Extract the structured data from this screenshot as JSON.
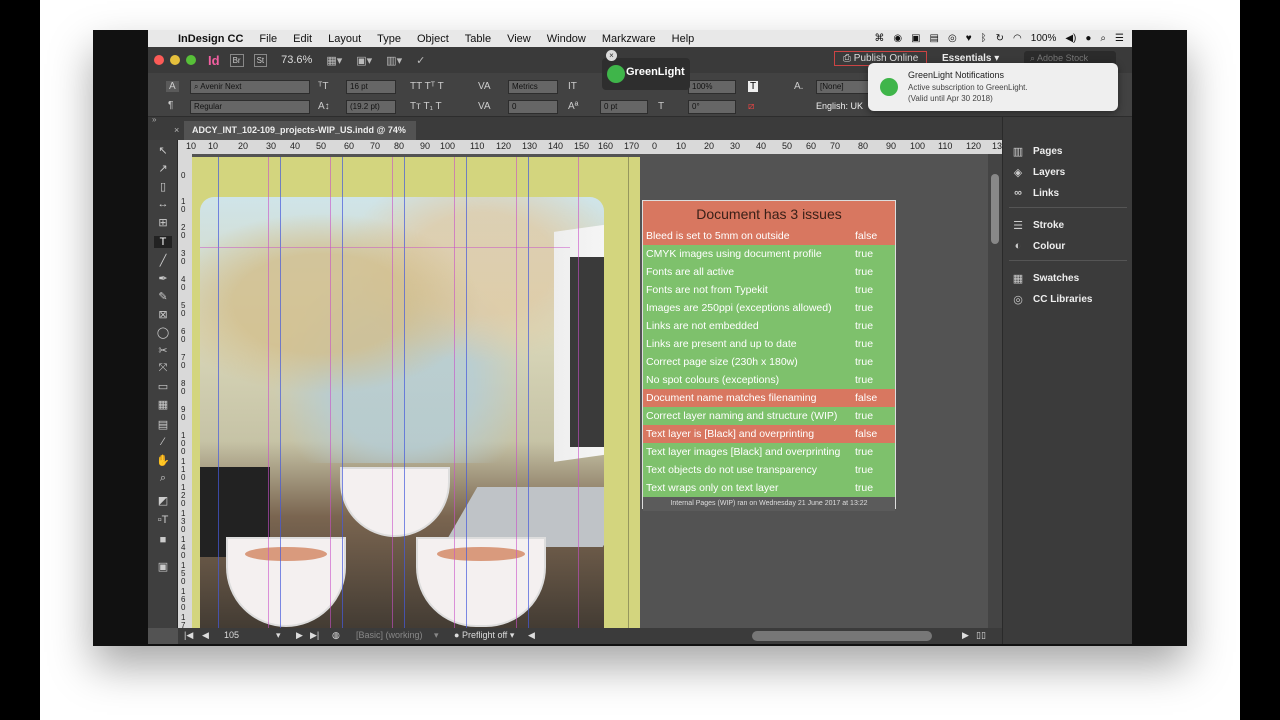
{
  "menubar": {
    "app": "InDesign CC",
    "items": [
      "File",
      "Edit",
      "Layout",
      "Type",
      "Object",
      "Table",
      "View",
      "Window",
      "Markzware",
      "Help"
    ],
    "battery": "100%"
  },
  "appbar": {
    "app_icon": "Id",
    "bridge": "Br",
    "stock": "St",
    "zoom": "73.6%",
    "publish": "Publish Online",
    "workspace": "Essentials",
    "search_placeholder": "Adobe Stock"
  },
  "control": {
    "font_family": "Avenir Next",
    "font_style": "Regular",
    "font_size": "16 pt",
    "leading": "(19.2 pt)",
    "kerning": "Metrics",
    "tracking": "0",
    "vscale": "100%",
    "baseline": "0 pt",
    "skew": "0°",
    "char_style": "[None]",
    "language": "English: UK"
  },
  "document_tab": {
    "title": "ADCY_INT_102-109_projects-WIP_US.indd @ 74%"
  },
  "ruler": {
    "h_ticks": [
      "10",
      "10",
      "20",
      "30",
      "40",
      "50",
      "60",
      "70",
      "80",
      "90",
      "100",
      "110",
      "120",
      "130",
      "140",
      "150",
      "160",
      "170",
      "0",
      "10",
      "20",
      "30",
      "40",
      "50",
      "60",
      "70",
      "80",
      "90",
      "100",
      "110",
      "120",
      "130",
      "14"
    ],
    "v_ticks": [
      "0",
      "10",
      "20",
      "30",
      "40",
      "50",
      "60",
      "70",
      "80",
      "90",
      "100",
      "110",
      "120",
      "130",
      "140",
      "150",
      "160",
      "170"
    ]
  },
  "preflight": {
    "title": "Document has 3 issues",
    "checks": [
      {
        "label": "Bleed is set to 5mm on outside",
        "value": "false"
      },
      {
        "label": "CMYK images using document profile",
        "value": "true"
      },
      {
        "label": "Fonts are all active",
        "value": "true"
      },
      {
        "label": "Fonts are not from Typekit",
        "value": "true"
      },
      {
        "label": "Images are 250ppi (exceptions allowed)",
        "value": "true"
      },
      {
        "label": "Links are not embedded",
        "value": "true"
      },
      {
        "label": "Links are present and up to date",
        "value": "true"
      },
      {
        "label": "Correct page size (230h x 180w)",
        "value": "true"
      },
      {
        "label": "No spot colours (exceptions)",
        "value": "true"
      },
      {
        "label": "Document name matches filenaming",
        "value": "false"
      },
      {
        "label": "Correct layer naming and structure (WIP)",
        "value": "true"
      },
      {
        "label": "Text layer is [Black] and overprinting",
        "value": "false"
      },
      {
        "label": "Text layer images [Black] and overprinting",
        "value": "true"
      },
      {
        "label": "Text objects do not use transparency",
        "value": "true"
      },
      {
        "label": "Text wraps only on text layer",
        "value": "true"
      }
    ],
    "footer": "Internal Pages (WIP) ran on Wednesday 21 June 2017 at 13:22",
    "colors": {
      "pass": "#7ec16c",
      "fail": "#d87760"
    }
  },
  "panels": {
    "items": [
      "Pages",
      "Layers",
      "Links",
      "Stroke",
      "Colour",
      "Swatches",
      "CC Libraries"
    ]
  },
  "statusbar": {
    "page": "105",
    "style": "[Basic] (working)",
    "preflight": "Preflight off"
  },
  "notification": {
    "title": "GreenLight Notifications",
    "line1": "Active subscription to GreenLight.",
    "line2": "(Valid until Apr 30 2018)"
  },
  "greenlight": {
    "name": "GreenLight"
  }
}
